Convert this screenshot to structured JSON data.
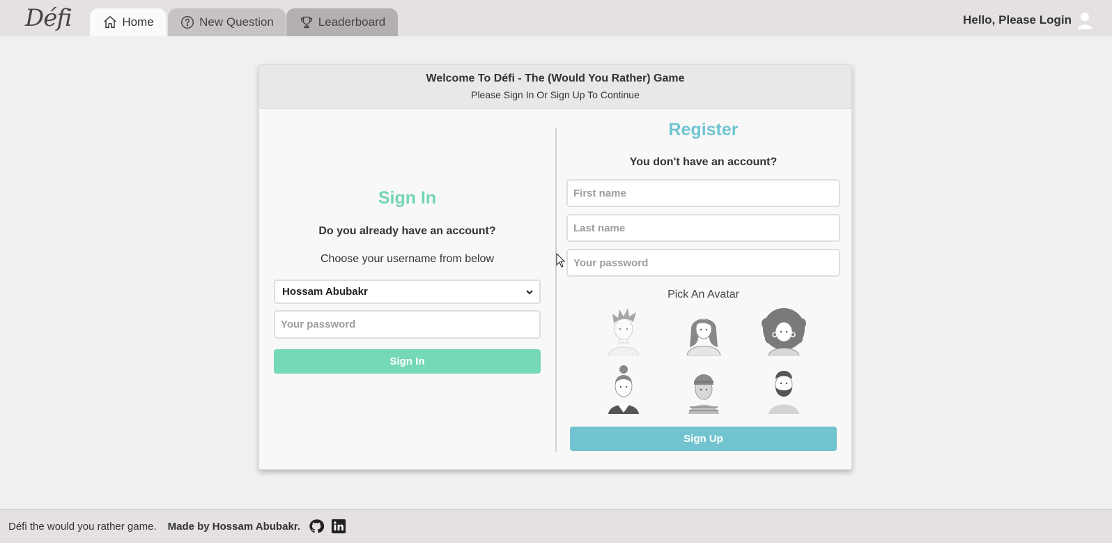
{
  "nav": {
    "logo": "Défi",
    "tabs": [
      {
        "label": "Home",
        "icon": "home-icon"
      },
      {
        "label": "New Question",
        "icon": "question-circle-icon"
      },
      {
        "label": "Leaderboard",
        "icon": "trophy-icon"
      }
    ],
    "greeting": "Hello, Please Login"
  },
  "card": {
    "title": "Welcome To Défi - The (Would You Rather) Game",
    "subtitle": "Please Sign In Or Sign Up To Continue"
  },
  "signin": {
    "title": "Sign In",
    "question": "Do you already have an account?",
    "choose": "Choose your username from below",
    "selected_user": "Hossam Abubakr",
    "password_placeholder": "Your password",
    "button": "Sign In"
  },
  "register": {
    "title": "Register",
    "question": "You don't have an account?",
    "first_name_placeholder": "First name",
    "last_name_placeholder": "Last name",
    "password_placeholder": "Your password",
    "pick_avatar": "Pick An Avatar",
    "avatars": [
      "avatar-1",
      "avatar-2",
      "avatar-3",
      "avatar-4",
      "avatar-5",
      "avatar-6"
    ],
    "button": "Sign Up"
  },
  "footer": {
    "text": "Défi the would you rather game.",
    "made_by": "Made by Hossam Abubakr.",
    "icons": [
      "github-icon",
      "linkedin-icon"
    ]
  },
  "colors": {
    "signin_accent": "#73d5b3",
    "register_accent": "#71c4d2",
    "nav_bg": "#e4e0e4"
  }
}
